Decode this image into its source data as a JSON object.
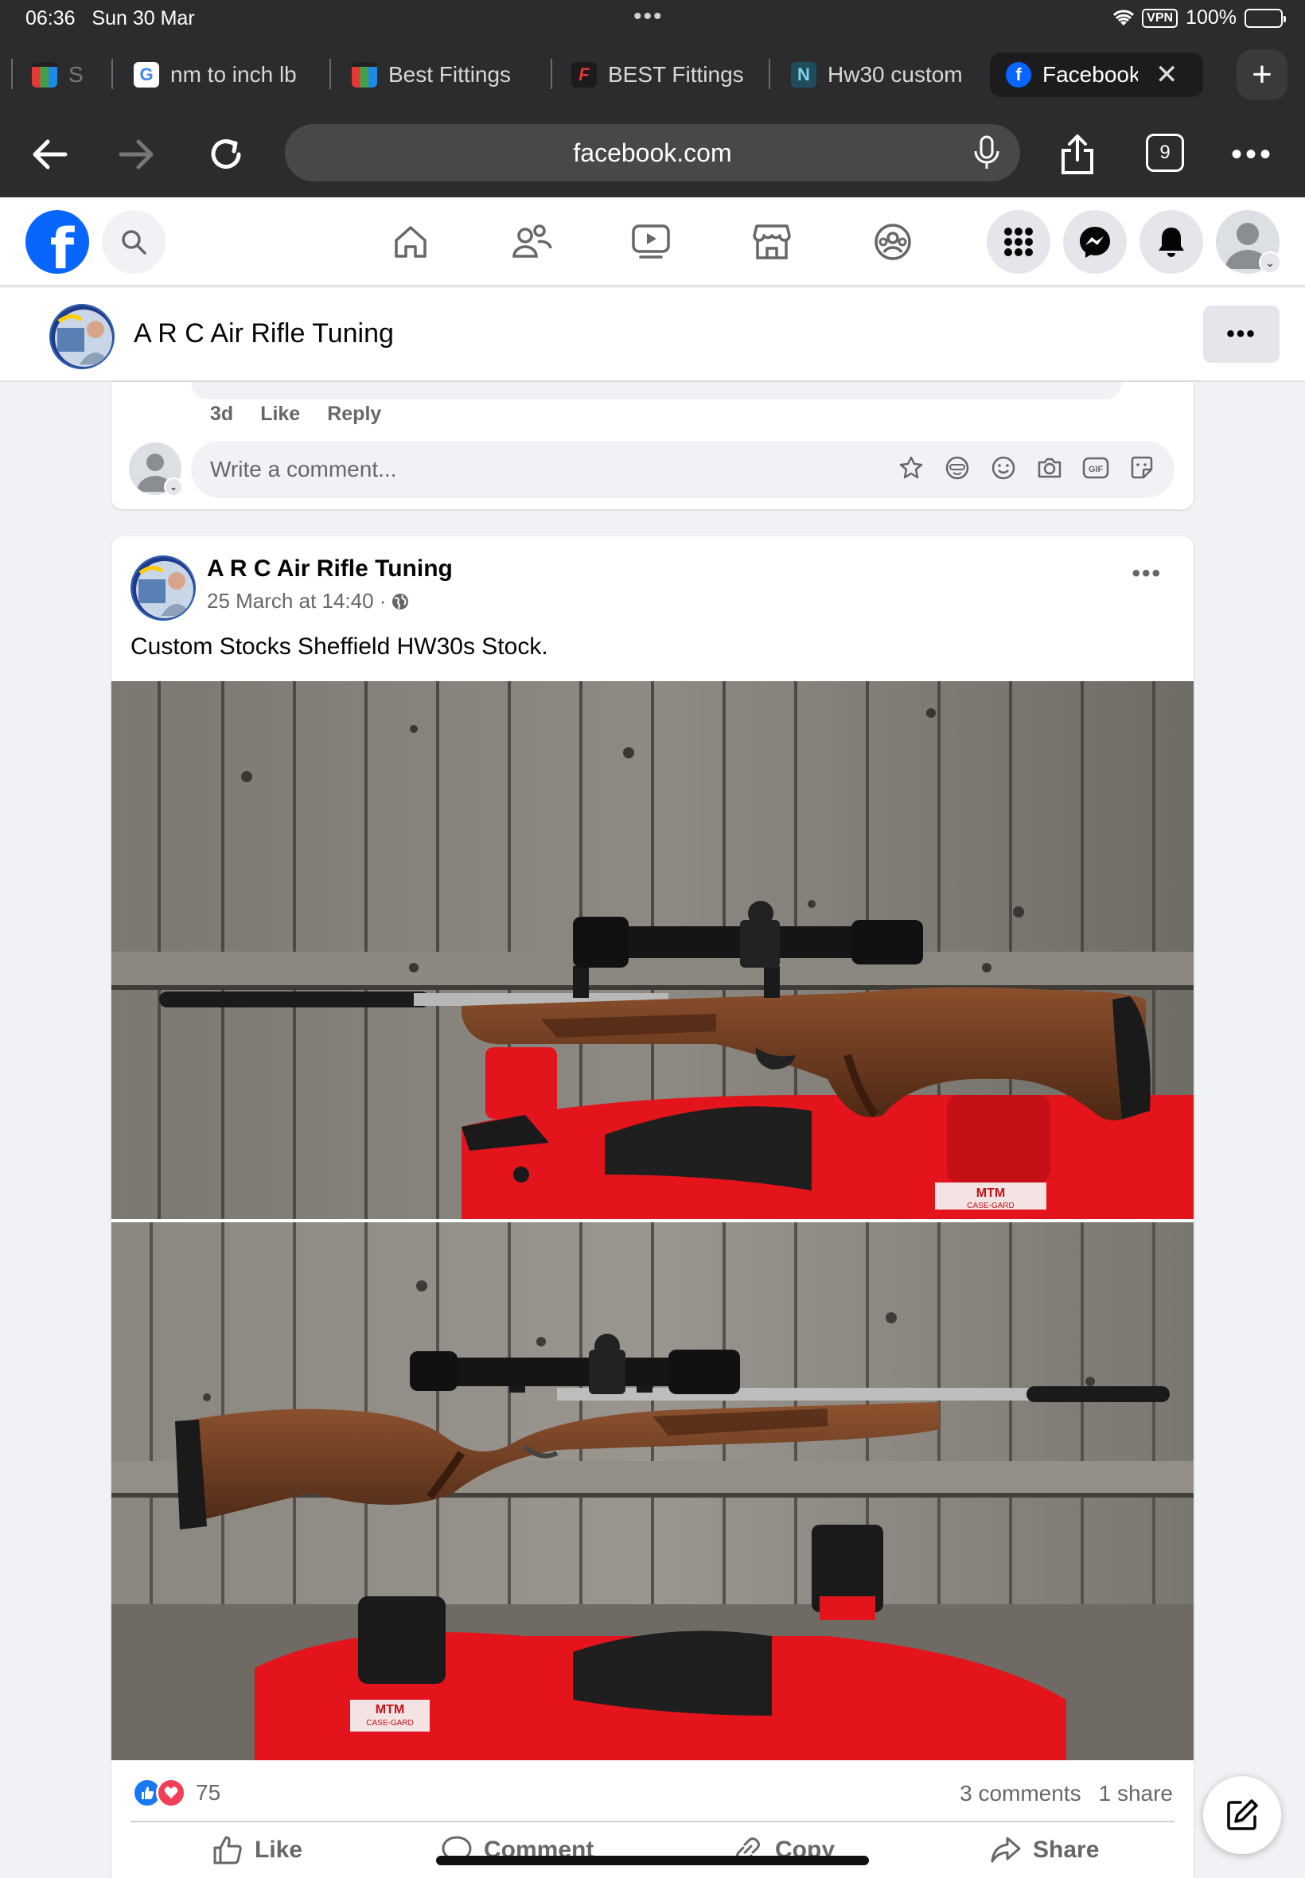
{
  "status_bar": {
    "time": "06:36",
    "date": "Sun 30 Mar",
    "vpn": "VPN",
    "battery": "100%"
  },
  "browser": {
    "tabs": [
      {
        "label": "S",
        "favicon": "shop-bag-icon"
      },
      {
        "label": "nm to inch lb",
        "favicon": "google-icon"
      },
      {
        "label": "Best Fittings",
        "favicon": "shop-bag-icon"
      },
      {
        "label": "BEST Fittings",
        "favicon": "brand-f-icon"
      },
      {
        "label": "Hw30 custom",
        "favicon": "site-n-icon"
      },
      {
        "label": "Facebook",
        "favicon": "facebook-icon",
        "active": true
      }
    ],
    "url": "facebook.com",
    "tab_count": "9"
  },
  "page": {
    "name": "A R C Air Rifle Tuning"
  },
  "previous_comment": {
    "age": "3d",
    "like": "Like",
    "reply": "Reply"
  },
  "comment_box": {
    "placeholder": "Write a comment..."
  },
  "post": {
    "author": "A R C Air Rifle Tuning",
    "timestamp": "25 March at 14:40 ·",
    "text": "Custom Stocks Sheffield HW30s Stock.",
    "reaction_count": "75",
    "comments": "3 comments",
    "shares": "1 share",
    "actions": {
      "like": "Like",
      "comment": "Comment",
      "copy": "Copy",
      "share": "Share"
    }
  },
  "photo_text": {
    "brand": "MTM",
    "sub": "CASE-GARD"
  },
  "colors": {
    "fb_blue": "#0866ff",
    "chrome_dark": "#2c2c2e",
    "wood": "#6b3a1f",
    "rest_red": "#e4141c"
  }
}
